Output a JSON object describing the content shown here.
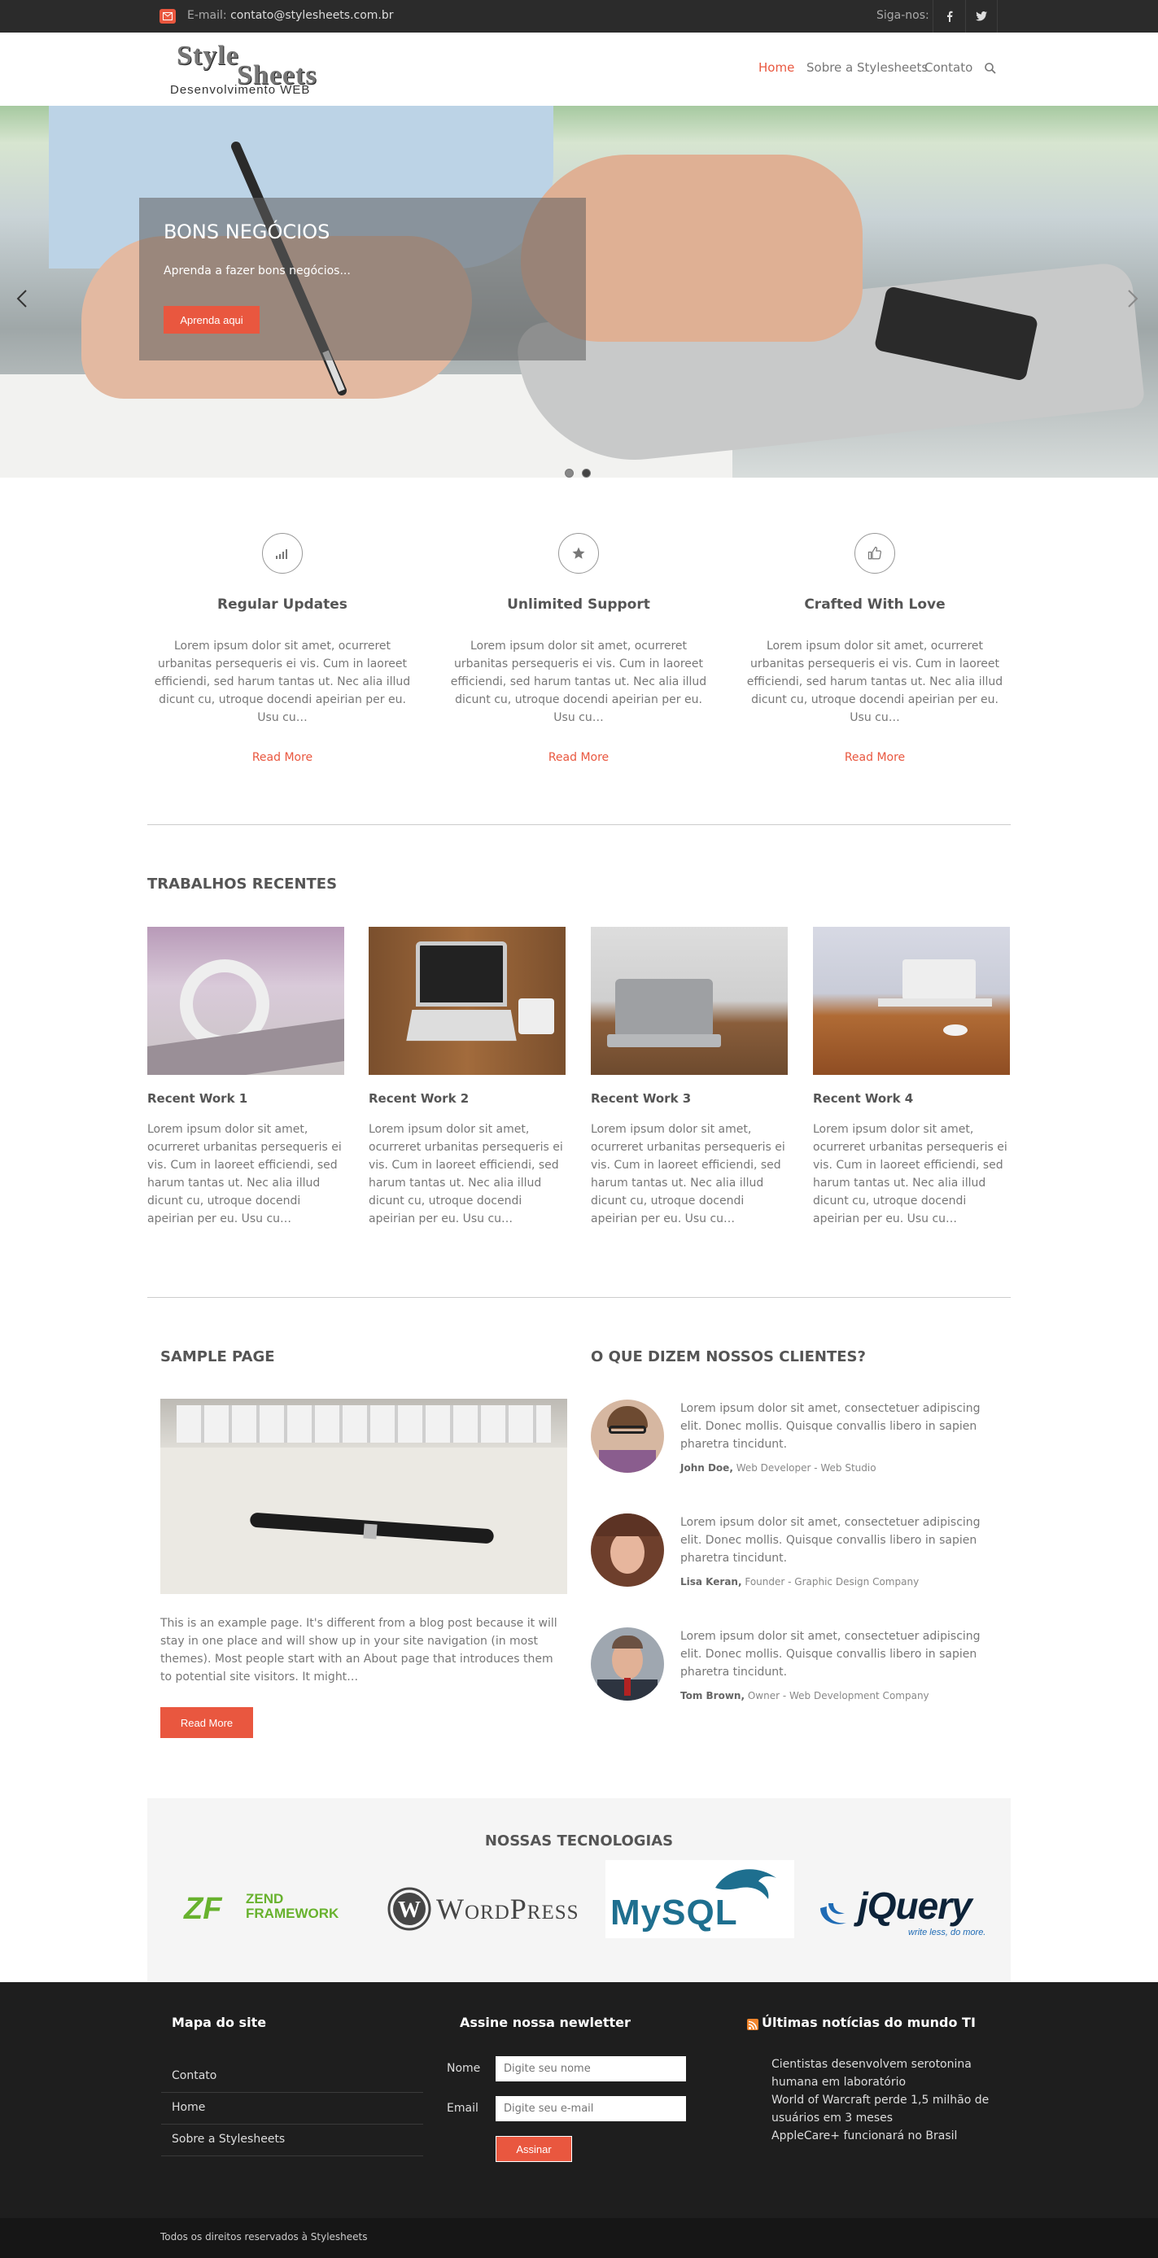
{
  "topbar": {
    "email_label": "E-mail:",
    "email": "contato@stylesheets.com.br",
    "follow_label": "Siga-nos:",
    "social_icons": [
      "facebook-icon",
      "twitter-icon"
    ]
  },
  "header": {
    "logo_line1": "Style",
    "logo_line2": "Sheets",
    "logo_line3": "Desenvolvimento WEB",
    "nav": [
      "Home",
      "Sobre a Stylesheets",
      "Contato"
    ],
    "active_nav": "Home",
    "search_icon": "search-icon"
  },
  "hero": {
    "title": "BONS NEGÓCIOS",
    "text": "Aprenda a fazer bons negócios...",
    "button": "Aprenda aqui",
    "slides": 2,
    "active_slide": 2
  },
  "features": [
    {
      "icon": "bar-chart-icon",
      "title": "Regular Updates",
      "text": "Lorem ipsum dolor sit amet, ocurreret urbanitas persequeris ei vis. Cum in laoreet efficiendi, sed harum tantas ut. Nec alia illud dicunt cu, utroque docendi apeirian per eu. Usu cu…",
      "more": "Read More"
    },
    {
      "icon": "star-icon",
      "title": "Unlimited Support",
      "text": "Lorem ipsum dolor sit amet, ocurreret urbanitas persequeris ei vis. Cum in laoreet efficiendi, sed harum tantas ut. Nec alia illud dicunt cu, utroque docendi apeirian per eu. Usu cu…",
      "more": "Read More"
    },
    {
      "icon": "thumbs-up-icon",
      "title": "Crafted With Love",
      "text": "Lorem ipsum dolor sit amet, ocurreret urbanitas persequeris ei vis. Cum in laoreet efficiendi, sed harum tantas ut. Nec alia illud dicunt cu, utroque docendi apeirian per eu. Usu cu…",
      "more": "Read More"
    }
  ],
  "works": {
    "title": "TRABALHOS RECENTES",
    "items": [
      {
        "title": "Recent Work 1",
        "text": "Lorem ipsum dolor sit amet, ocurreret urbanitas persequeris ei vis. Cum in laoreet efficiendi, sed harum tantas ut. Nec alia illud dicunt cu, utroque docendi apeirian per eu. Usu cu…"
      },
      {
        "title": "Recent Work 2",
        "text": "Lorem ipsum dolor sit amet, ocurreret urbanitas persequeris ei vis. Cum in laoreet efficiendi, sed harum tantas ut. Nec alia illud dicunt cu, utroque docendi apeirian per eu. Usu cu…"
      },
      {
        "title": "Recent Work 3",
        "text": "Lorem ipsum dolor sit amet, ocurreret urbanitas persequeris ei vis. Cum in laoreet efficiendi, sed harum tantas ut. Nec alia illud dicunt cu, utroque docendi apeirian per eu. Usu cu…"
      },
      {
        "title": "Recent Work 4",
        "text": "Lorem ipsum dolor sit amet, ocurreret urbanitas persequeris ei vis. Cum in laoreet efficiendi, sed harum tantas ut. Nec alia illud dicunt cu, utroque docendi apeirian per eu. Usu cu…"
      }
    ]
  },
  "sample": {
    "title": "SAMPLE PAGE",
    "text": "This is an example page. It's different from a blog post because it will stay in one place and will show up in your site navigation (in most themes). Most people start with an About page that introduces them to potential site visitors. It might…",
    "button": "Read More"
  },
  "testimonials": {
    "title": "O QUE DIZEM NOSSOS CLIENTES?",
    "items": [
      {
        "quote": "Lorem ipsum dolor sit amet, consectetuer adipiscing elit. Donec mollis. Quisque convallis libero in sapien pharetra tincidunt.",
        "name": "John Doe,",
        "role": "Web Developer - Web Studio"
      },
      {
        "quote": "Lorem ipsum dolor sit amet, consectetuer adipiscing elit. Donec mollis. Quisque convallis libero in sapien pharetra tincidunt.",
        "name": "Lisa Keran,",
        "role": "Founder - Graphic Design Company"
      },
      {
        "quote": "Lorem ipsum dolor sit amet, consectetuer adipiscing elit. Donec mollis. Quisque convallis libero in sapien pharetra tincidunt.",
        "name": "Tom Brown,",
        "role": "Owner - Web Development Company"
      }
    ]
  },
  "technologies": {
    "title": "NOSSAS TECNOLOGIAS",
    "logos": [
      {
        "mark": "ZF",
        "line1": "ZEND",
        "line2": "FRAMEWORK"
      },
      {
        "text": "WordPress"
      },
      {
        "text": "MySQL"
      },
      {
        "text": "jQuery",
        "tagline": "write less, do more."
      }
    ]
  },
  "footer": {
    "sitemap_title": "Mapa do site",
    "sitemap_links": [
      "Contato",
      "Home",
      "Sobre a Stylesheets"
    ],
    "newsletter_title": "Assine nossa newletter",
    "name_label": "Nome",
    "name_placeholder": "Digite seu nome",
    "email_label": "Email",
    "email_placeholder": "Digite seu e-mail",
    "submit": "Assinar",
    "news_title": "Últimas notícias do mundo TI",
    "news": [
      "Cientistas desenvolvem serotonina humana em laboratório",
      "World of Warcraft perde 1,5 milhão de usuários em 3 meses",
      "AppleCare+ funcionará no Brasil"
    ],
    "copyright": "Todos os direitos reservados à Stylesheets"
  },
  "colors": {
    "accent": "#e9573f",
    "topbar": "#2b2b2b",
    "footer": "#1e1e1e"
  }
}
